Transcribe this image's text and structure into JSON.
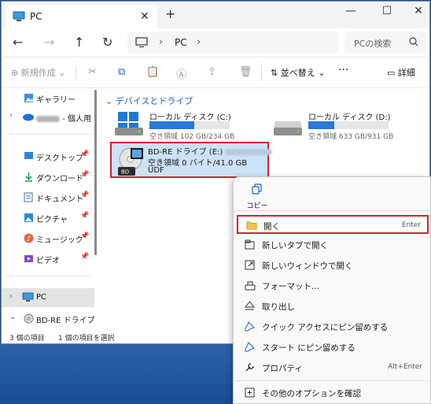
{
  "window": {
    "tab_title": "PC",
    "new_tab": "+",
    "minimize": "—",
    "maximize": "☐",
    "close": "✕"
  },
  "address": {
    "location": "PC",
    "search_placeholder": "PCの検索"
  },
  "toolbar": {
    "new_label": "新規作成",
    "sort_label": "並べ替え",
    "details_label": "詳細"
  },
  "nav": {
    "gallery": "ギャラリー",
    "onedrive": "- 個人用",
    "desktop": "デスクトップ",
    "downloads": "ダウンロード",
    "documents": "ドキュメント",
    "pictures": "ピクチャ",
    "music": "ミュージック",
    "videos": "ビデオ",
    "pc": "PC",
    "bd_drive": "BD-RE ドライブ (E"
  },
  "content": {
    "group_header": "デバイスとドライブ",
    "drives": [
      {
        "name": "ローカル ディスク (C:)",
        "free": "空き領域 102 GB/234 GB",
        "used_fraction": 0.56
      },
      {
        "name": "ローカル ディスク (D:)",
        "free": "空き領域 633 GB/931 GB",
        "used_fraction": 0.32
      }
    ],
    "bd": {
      "name": "BD-RE ドライブ (E:)",
      "free": "空き領域 0 バイト/41.0 GB",
      "fs": "UDF",
      "badge": "BD"
    }
  },
  "status": {
    "items": "3 個の項目",
    "selected": "1 個の項目を選択"
  },
  "context_menu": {
    "copy": "コピー",
    "open": "開く",
    "open_shortcut": "Enter",
    "open_new_tab": "新しいタブで開く",
    "open_new_window": "新しいウィンドウで開く",
    "format": "フォーマット...",
    "eject": "取り出し",
    "pin_quick": "クイック アクセスにピン留めする",
    "pin_start": "スタート にピン留めする",
    "properties": "プロパティ",
    "properties_shortcut": "Alt+Enter",
    "more_options": "その他のオプションを確認"
  }
}
